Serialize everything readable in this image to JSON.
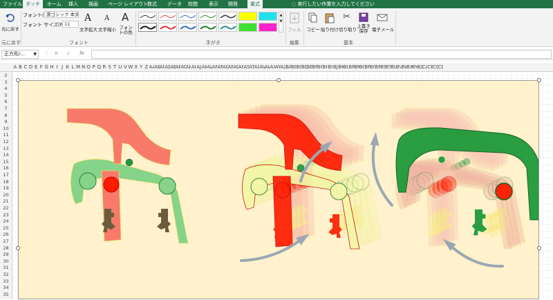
{
  "tabs": [
    "ファイル",
    "タッチ",
    "ホーム",
    "挿入",
    "描画",
    "ページ レイアウト",
    "数式",
    "データ",
    "校閲",
    "表示",
    "開発",
    "書式"
  ],
  "tell_me": "実行したい作業を入力してください",
  "undo": {
    "label": "元に戻す",
    "group": "元に戻す"
  },
  "font_group": {
    "font_label": "フォント(F):",
    "font_value": "游ゴシック 本文",
    "size_label": "フォント サイズ(F):",
    "size_value": "11",
    "enlarge": "文字拡大",
    "shrink": "文字縮小",
    "color": "フォントの色",
    "group": "フォント"
  },
  "ink_group": "手がき",
  "edit_group": {
    "fill": "フィル",
    "group": "編集"
  },
  "basic_group": {
    "copy": "コピー",
    "paste": "貼り付け",
    "cut": "切り取り",
    "overwrite": "上書き保存",
    "email": "電子メール",
    "group": "基本"
  },
  "name_box": "正方形/...",
  "fx": "fx",
  "columns": [
    "A",
    "B",
    "C",
    "D",
    "E",
    "F",
    "G",
    "H",
    "I",
    "J",
    "K",
    "L",
    "M",
    "N",
    "O",
    "P",
    "Q",
    "R",
    "S",
    "T",
    "U",
    "V",
    "W",
    "X",
    "Y",
    "Z",
    "AA",
    "AB",
    "AC",
    "AD",
    "AE",
    "AF",
    "AG",
    "AH",
    "AI",
    "AJ",
    "AK",
    "AL",
    "AM",
    "AN",
    "AO",
    "AP",
    "AQ",
    "AR",
    "AS",
    "AT",
    "AU",
    "AV",
    "AW",
    "AX",
    "AY",
    "AZ",
    "BA",
    "BB",
    "BC",
    "BD",
    "BE",
    "BF",
    "BG",
    "BH",
    "BI",
    "BJ",
    "BK",
    "BL",
    "BM",
    "BN",
    "BO",
    "BP",
    "BQ",
    "BR",
    "BS",
    "BT",
    "BU",
    "BV",
    "BW",
    "BX",
    "BY",
    "BZ",
    "CA",
    "CB",
    "CC",
    "CD"
  ],
  "rows": [
    "2",
    "3",
    "4",
    "5",
    "6",
    "7",
    "8",
    "9",
    "10",
    "11",
    "12",
    "13",
    "14",
    "15",
    "16",
    "17",
    "18",
    "19",
    "20",
    "21",
    "22",
    "23",
    "24",
    "25",
    "26",
    "27",
    "28",
    "29",
    "30",
    "31",
    "32",
    "33",
    "34",
    "35"
  ],
  "colors": {
    "excel_green": "#217346",
    "canvas": "#fff2cc",
    "salmon": "#f87a6a",
    "red": "#ff1a00",
    "light_green": "#86d38a",
    "dark_green": "#1f9a3a",
    "yellow_ghost": "#f3f7a6",
    "pad": "#6b5d3c",
    "arrow": "#9aa8b4"
  }
}
